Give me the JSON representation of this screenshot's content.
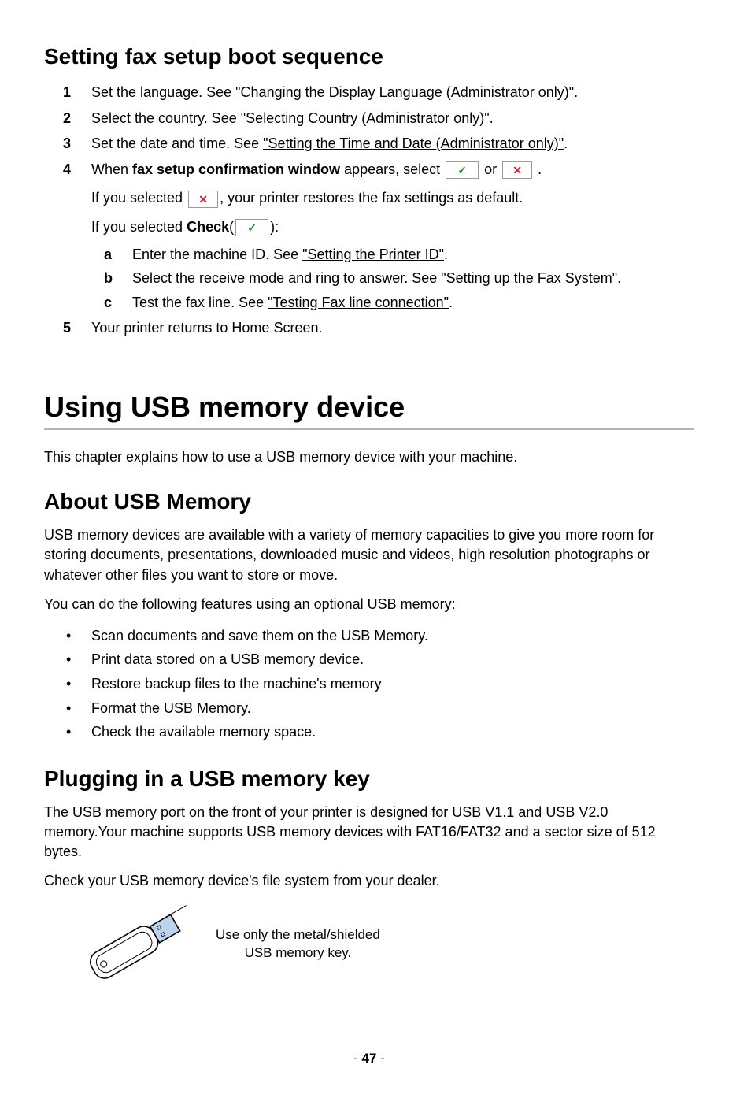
{
  "section1": {
    "heading": "Setting fax setup boot sequence",
    "steps": [
      {
        "marker": "1",
        "prefix": "Set the language. See ",
        "link": "\"Changing the Display Language (Administrator only)\"",
        "suffix": "."
      },
      {
        "marker": "2",
        "prefix": "Select the country. See ",
        "link": "\"Selecting Country (Administrator only)\"",
        "suffix": "."
      },
      {
        "marker": "3",
        "prefix": "Set the date and time. See ",
        "link": "\"Setting the Time and Date (Administrator only)\"",
        "suffix": "."
      }
    ],
    "step4": {
      "marker": "4",
      "line1_a": "When ",
      "line1_bold": "fax setup confirmation window",
      "line1_b": " appears, select ",
      "line1_or": " or ",
      "line1_end": " .",
      "line2_a": "If you selected ",
      "line2_b": ", your printer restores the fax settings as default.",
      "line3_a": "If you selected ",
      "line3_bold": "Check",
      "line3_b": "(",
      "line3_c": "):",
      "sub": [
        {
          "marker": "a",
          "prefix": "Enter the machine ID. See ",
          "link": "\"Setting the Printer ID\"",
          "suffix": "."
        },
        {
          "marker": "b",
          "prefix": "Select the receive mode and ring to answer. See ",
          "link": "\"Setting up the Fax System\"",
          "suffix": "."
        },
        {
          "marker": "c",
          "prefix": "Test the fax line. See ",
          "link": "\"Testing Fax line connection\"",
          "suffix": "."
        }
      ]
    },
    "step5": {
      "marker": "5",
      "text": "Your printer returns to Home Screen."
    }
  },
  "section2": {
    "heading": "Using USB memory device",
    "intro": "This chapter explains how to use a USB memory device with your machine."
  },
  "section3": {
    "heading": "About USB Memory",
    "para1": "USB memory devices are available with a variety of memory capacities to give you more room for storing documents, presentations, downloaded music and videos, high resolution photographs or whatever other files you want to store or move.",
    "para2": "You can do the following features using an optional USB memory:",
    "bullets": [
      "Scan documents and save them on the USB Memory.",
      "Print data stored on a USB memory device.",
      "Restore backup files to the machine's memory",
      "Format the USB Memory.",
      "Check the available memory space."
    ]
  },
  "section4": {
    "heading": "Plugging in a USB memory key",
    "para1": "The USB memory port on the front of your printer is designed for USB V1.1 and USB V2.0 memory.Your machine supports USB memory devices with FAT16/FAT32 and a sector size of 512 bytes.",
    "para2": "Check your USB memory device's file system from your dealer.",
    "fig_label_l1": "Use only the metal/shielded",
    "fig_label_l2": "USB memory key."
  },
  "pagenum": {
    "dash1": "- ",
    "num": "47",
    "dash2": " -"
  }
}
